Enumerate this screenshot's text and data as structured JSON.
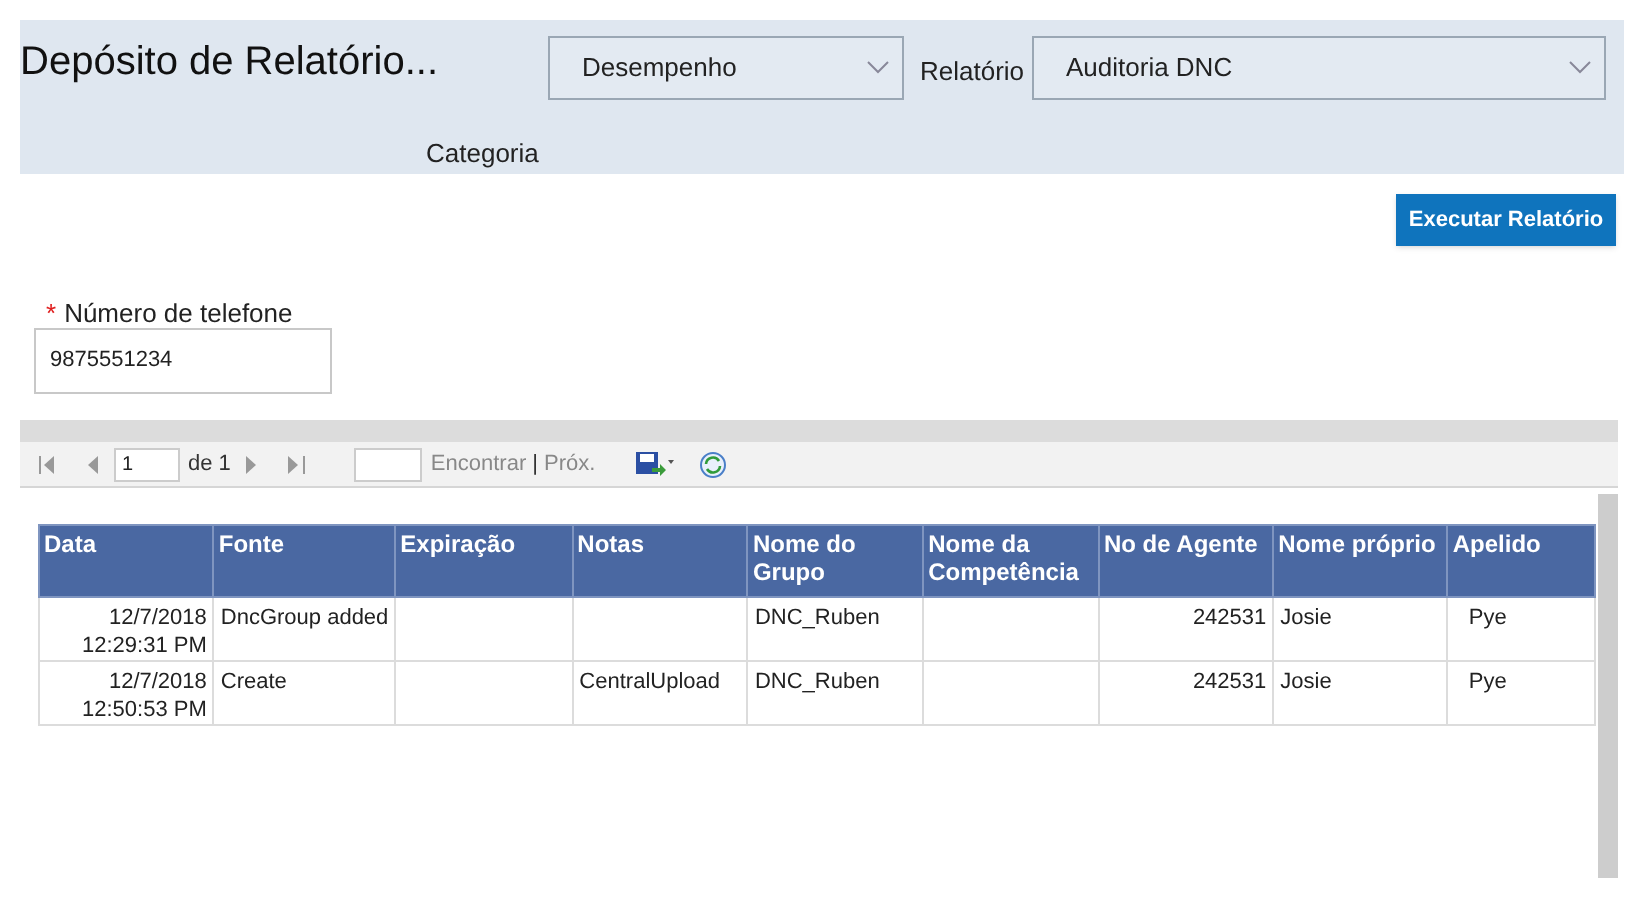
{
  "header": {
    "title": "Depósito de Relatório...",
    "category": {
      "value": "Desempenho",
      "label": "Categoria"
    },
    "report": {
      "label": "Relatório",
      "value": "Auditoria DNC"
    }
  },
  "run_button": "Executar Relatório",
  "parameter": {
    "required_mark": "*",
    "label": "Número de telefone",
    "value": "9875551234"
  },
  "toolbar": {
    "page": "1",
    "page_total": "de 1",
    "find": "Encontrar",
    "separator": "|",
    "next": "Próx."
  },
  "table": {
    "columns": [
      "Data",
      "Fonte",
      "Expiração",
      "Notas",
      "Nome do Grupo",
      "Nome da Competência",
      "No de Agente",
      "Nome próprio",
      "Apelido"
    ],
    "rows": [
      [
        "12/7/2018 12:29:31 PM",
        "DncGroup added",
        "",
        "",
        "DNC_Ruben",
        "",
        "242531",
        "Josie",
        "Pye"
      ],
      [
        "12/7/2018 12:50:53 PM",
        "Create",
        "",
        "CentralUpload",
        "DNC_Ruben",
        "",
        "242531",
        "Josie",
        "Pye"
      ]
    ]
  }
}
